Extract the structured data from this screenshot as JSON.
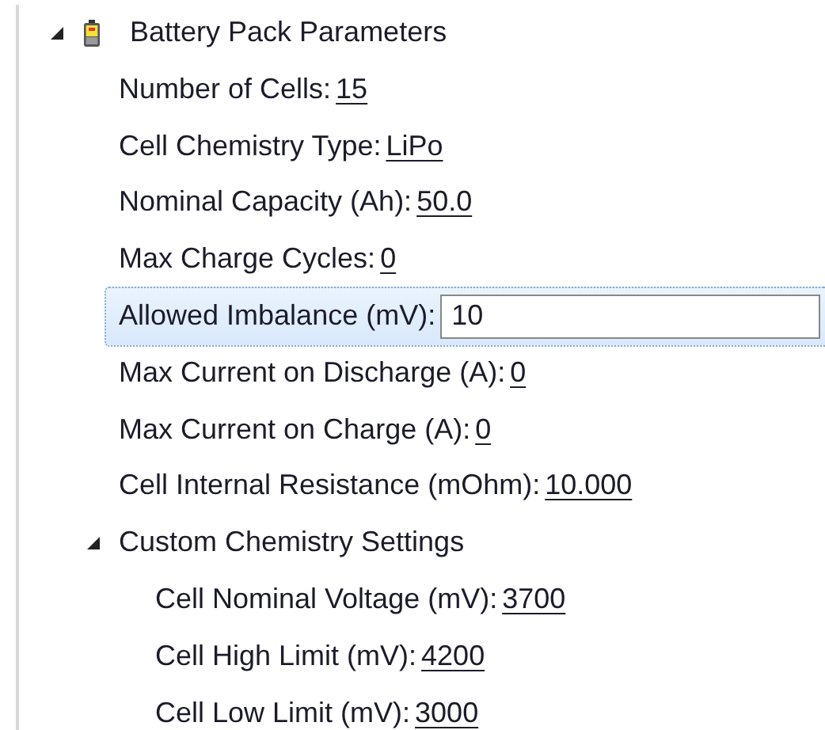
{
  "tree": [
    {
      "kind": "group",
      "label": "Battery Pack Parameters",
      "expanded": true,
      "children": [
        {
          "kind": "field",
          "label": "Number of Cells:",
          "value": "15",
          "editing": false
        },
        {
          "kind": "field",
          "label": "Cell Chemistry Type:",
          "value": "LiPo",
          "editing": false
        },
        {
          "kind": "field",
          "label": "Nominal Capacity (Ah):",
          "value": "50.0",
          "editing": false
        },
        {
          "kind": "field",
          "label": "Max Charge Cycles:",
          "value": "0",
          "editing": false
        },
        {
          "kind": "field",
          "label": "Allowed Imbalance (mV):",
          "value": "10",
          "editing": true
        },
        {
          "kind": "field",
          "label": "Max Current on Discharge (A):",
          "value": "0",
          "editing": false
        },
        {
          "kind": "field",
          "label": "Max Current on Charge (A):",
          "value": "0",
          "editing": false
        },
        {
          "kind": "field",
          "label": "Cell Internal Resistance (mOhm):",
          "value": "10.000",
          "editing": false
        },
        {
          "kind": "group",
          "label": "Custom Chemistry Settings",
          "expanded": true,
          "children": [
            {
              "kind": "field",
              "label": "Cell Nominal Voltage (mV):",
              "value": "3700",
              "editing": false
            },
            {
              "kind": "field",
              "label": "Cell High Limit (mV):",
              "value": "4200",
              "editing": false
            },
            {
              "kind": "field",
              "label": "Cell Low Limit (mV):",
              "value": "3000",
              "editing": false
            }
          ]
        }
      ]
    }
  ]
}
